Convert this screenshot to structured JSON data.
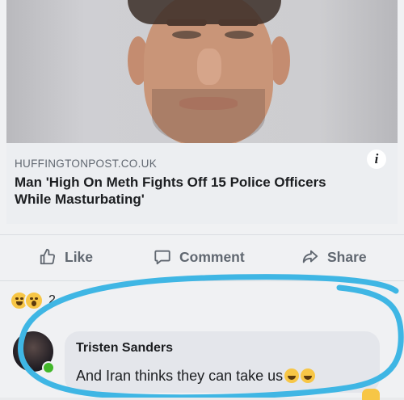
{
  "link_preview": {
    "source": "HUFFINGTONPOST.CO.UK",
    "headline": "Man 'High On Meth Fights Off 15 Police Officers While Masturbating'",
    "info_icon": "i"
  },
  "actions": {
    "like_label": "Like",
    "comment_label": "Comment",
    "share_label": "Share"
  },
  "reactions": {
    "icons": [
      "laugh-emoji",
      "wow-emoji"
    ],
    "count": "2"
  },
  "comment": {
    "author": "Tristen Sanders",
    "text": "And Iran thinks they can take us",
    "trailing_emojis": [
      "laugh-emoji",
      "laugh-emoji"
    ],
    "author_online": true
  },
  "colors": {
    "annotation_circle": "#3fb6e4",
    "online_dot": "#42b72a",
    "action_gray": "#606770"
  }
}
